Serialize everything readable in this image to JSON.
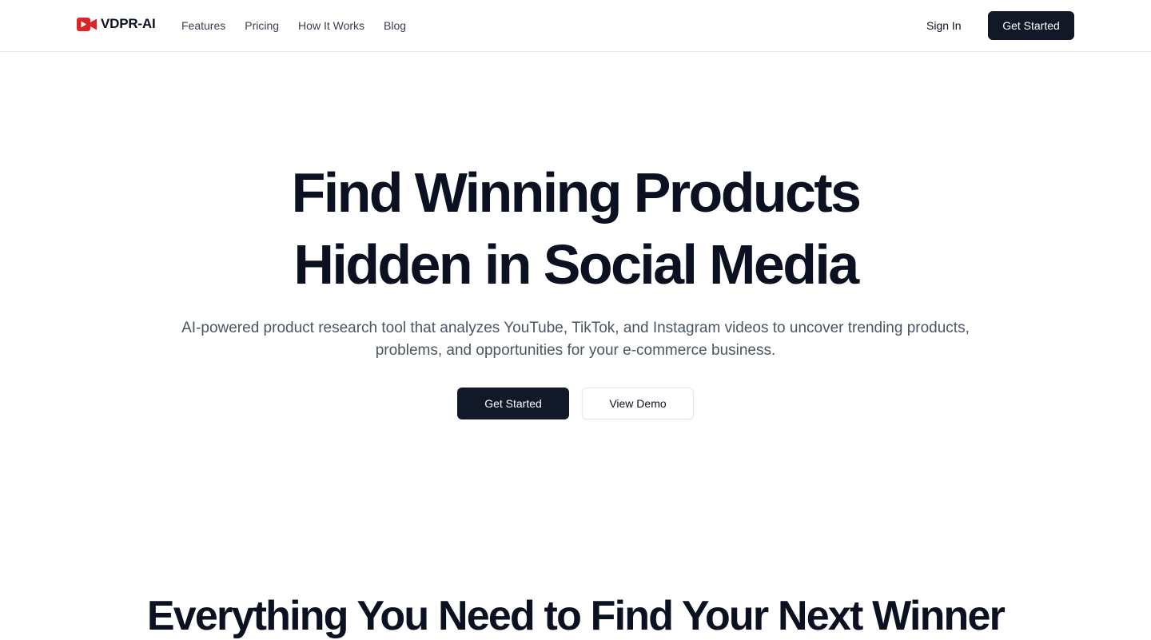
{
  "brand": {
    "name": "VDPR-AI",
    "icon": "video-camera-icon",
    "accent_color": "#dc2626"
  },
  "nav": {
    "links": [
      "Features",
      "Pricing",
      "How It Works",
      "Blog"
    ]
  },
  "header": {
    "signin_label": "Sign In",
    "cta_label": "Get Started"
  },
  "hero": {
    "title_line1": "Find Winning Products",
    "title_line2": "Hidden in Social Media",
    "subtitle": "AI-powered product research tool that analyzes YouTube, TikTok, and Instagram videos to uncover trending products, problems, and opportunities for your e-commerce business.",
    "primary_label": "Get Started",
    "secondary_label": "View Demo"
  },
  "features_section": {
    "title": "Everything You Need to Find Your Next Winner"
  },
  "colors": {
    "primary_button": "#111827",
    "text": "#0b1120",
    "muted_text": "#4b5563"
  }
}
